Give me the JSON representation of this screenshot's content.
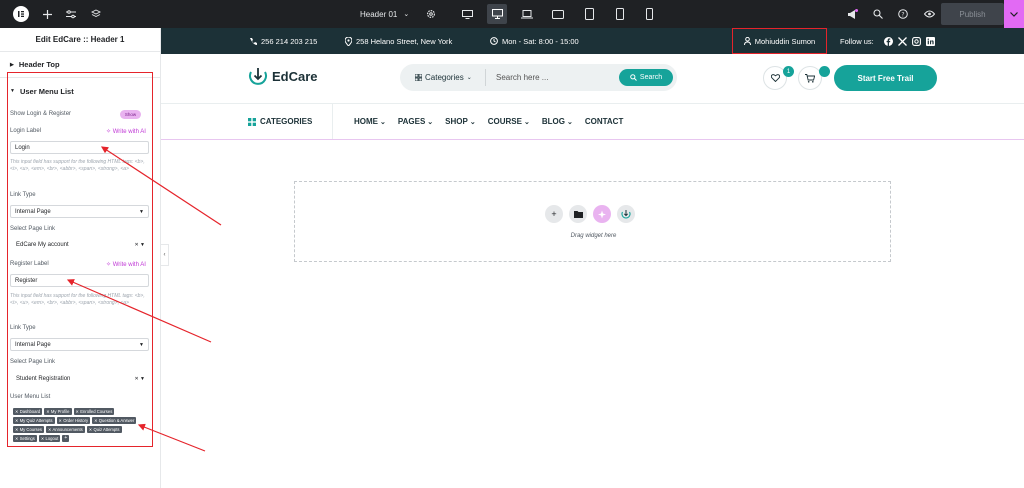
{
  "editor": {
    "doc_title": "Header 01",
    "publish_label": "Publish",
    "panel_title": "Edit EdCare :: Header 1"
  },
  "panel": {
    "sections": [
      "Header Top",
      "User Menu List"
    ],
    "show_login_label": "Show Login & Register",
    "toggle_label": "Show",
    "login_label_title": "Login Label",
    "write_ai": "Write with AI",
    "login_value": "Login",
    "help_text": "This input field has support for the following HTML tags: <b>, <i>, <u>, <em>, <br>, <abbr>, <span>, <strong>, <a>",
    "link_type_title": "Link Type",
    "link_type_value": "Internal Page",
    "page_link_title": "Select Page Link",
    "login_page_value": "EdCare My account",
    "register_label_title": "Register Label",
    "register_value": "Register",
    "register_page_value": "Student Registration",
    "user_menu_title": "User Menu List",
    "tags": [
      "Dashboard",
      "My Profile",
      "Enrolled Courses",
      "My Quiz Attempts",
      "Order History",
      "Question & Answer",
      "My Courses",
      "Announcements",
      "Quiz Attempts",
      "Settings",
      "Logout"
    ]
  },
  "site": {
    "phone": "256 214 203 215",
    "address": "258 Helano Street, New York",
    "hours": "Mon - Sat: 8:00 - 15:00",
    "user_name": "Mohiuddin Sumon",
    "follow_label": "Follow us:",
    "brand": "EdCare",
    "categories_dd": "Categories",
    "search_placeholder": "Search here ...",
    "search_button": "Search",
    "wishlist_count": "1",
    "cta": "Start Free Trail",
    "nav_categories": "CATEGORIES",
    "nav": [
      {
        "label": "HOME"
      },
      {
        "label": "PAGES"
      },
      {
        "label": "SHOP"
      },
      {
        "label": "COURSE"
      },
      {
        "label": "BLOG"
      },
      {
        "label": "CONTACT"
      }
    ],
    "drag_text": "Drag widget here"
  },
  "colors": {
    "accent": "#16a39a",
    "dark": "#1c3137",
    "highlight_red": "#e5242b",
    "elementor_pink": "#e26af4"
  }
}
